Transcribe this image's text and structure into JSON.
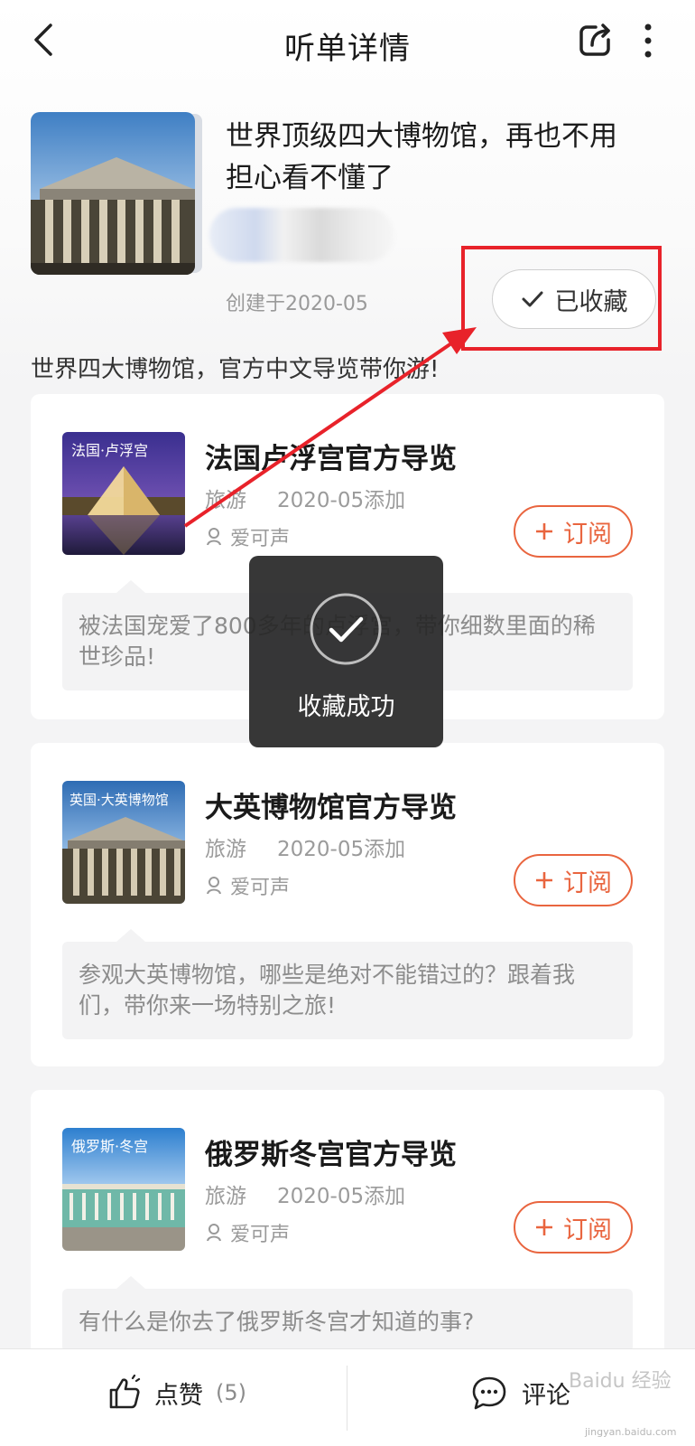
{
  "header": {
    "title": "听单详情"
  },
  "playlist": {
    "title": "世界顶级四大博物馆，再也不用担心看不懂了",
    "created": "创建于2020-05",
    "collected_label": "已收藏",
    "description": "世界四大博物馆，官方中文导览带你游!"
  },
  "items": [
    {
      "thumb_caption": "法国·卢浮宫",
      "title": "法国卢浮宫官方导览",
      "category": "旅游",
      "added": "2020-05添加",
      "author": "爱可声",
      "subscribe_label": "订阅",
      "description": "被法国宠爱了800多年的卢浮宫，带你细数里面的稀世珍品!"
    },
    {
      "thumb_caption": "英国·大英博物馆",
      "title": "大英博物馆官方导览",
      "category": "旅游",
      "added": "2020-05添加",
      "author": "爱可声",
      "subscribe_label": "订阅",
      "description": "参观大英博物馆，哪些是绝对不能错过的？跟着我们，带你来一场特别之旅!"
    },
    {
      "thumb_caption": "俄罗斯·冬宫",
      "title": "俄罗斯冬宫官方导览",
      "category": "旅游",
      "added": "2020-05添加",
      "author": "爱可声",
      "subscribe_label": "订阅",
      "description": "有什么是你去了俄罗斯冬宫才知道的事?"
    }
  ],
  "toast": {
    "text": "收藏成功"
  },
  "bottom_bar": {
    "like_label": "点赞",
    "like_count": "(5)",
    "comment_label": "评论"
  },
  "watermark": {
    "text": "Baidu 经验",
    "sub": "jingyan.baidu.com"
  },
  "colors": {
    "accent": "#e9653f",
    "highlight": "#e8222a",
    "toast_bg": "#262626"
  },
  "icons": [
    "back-arrow-icon",
    "share-icon",
    "more-vertical-icon",
    "checkmark-icon",
    "plus-icon",
    "user-icon",
    "thumbs-up-icon",
    "comment-bubble-icon"
  ]
}
